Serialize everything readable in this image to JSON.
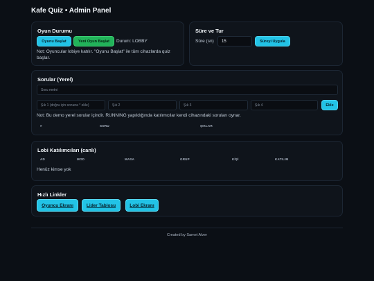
{
  "header": {
    "title": "Kafe Quiz • Admin Panel"
  },
  "status_card": {
    "title": "Oyun Durumu",
    "start_label": "Oyunu Başlat",
    "new_game_label": "Yeni Oyun Başlat",
    "state_text": "Durum: LOBBY",
    "note": "Not: Oyuncular lobiye katılır. \"Oyunu Başlat\" ile tüm cihazlarda quiz başlar."
  },
  "time_card": {
    "title": "Süre ve Tur",
    "duration_label": "Süre (sn)",
    "duration_value": "15",
    "apply_label": "Süreyi Uygula"
  },
  "questions_card": {
    "title": "Sorular (Yerel)",
    "question_placeholder": "Soru metni",
    "option1_placeholder": "Şık 1 (doğru için sonuna * ekle)",
    "option2_placeholder": "Şık 2",
    "option3_placeholder": "Şık 3",
    "option4_placeholder": "Şık 4",
    "add_label": "Ekle",
    "note": "Not: Bu demo yerel sorular içindir. RUNNING yapıldığında katılımcılar kendi cihazındaki soruları oynar.",
    "columns": [
      "#",
      "SORU",
      "ŞIKLAR"
    ]
  },
  "lobby_card": {
    "title": "Lobi Katılımcıları (canlı)",
    "columns": [
      "AD",
      "MOD",
      "MASA",
      "GRUP",
      "KİŞİ",
      "KATILIM"
    ],
    "empty_text": "Henüz kimse yok"
  },
  "links_card": {
    "title": "Hızlı Linkler",
    "player_label": "Oyuncu Ekranı",
    "leaderboard_label": "Lider Tablosu",
    "lobby_label": "Lobi Ekranı"
  },
  "footer": {
    "text": "Created by Samet Alver"
  },
  "colors": {
    "accent": "#22c3e6",
    "success": "#22b35a",
    "background": "#0b0f15"
  }
}
